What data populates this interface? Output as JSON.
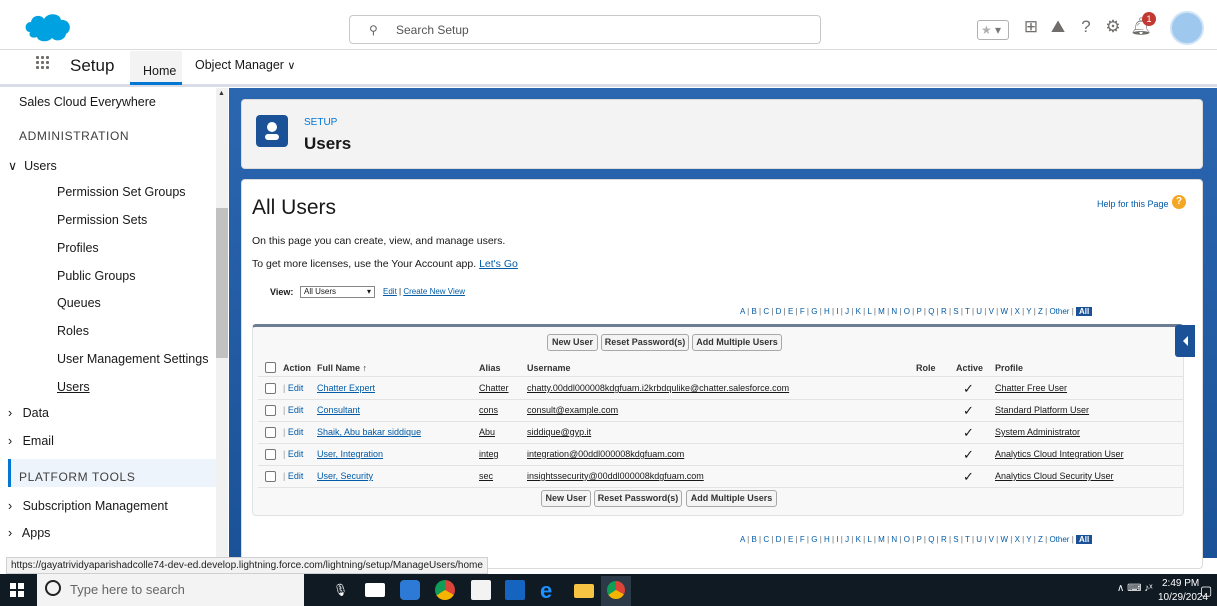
{
  "header": {
    "search_placeholder": "Search Setup",
    "notification_count": "1"
  },
  "nav": {
    "app_name": "Setup",
    "tabs": [
      "Home",
      "Object Manager"
    ]
  },
  "sidebar": {
    "top_item": "Sales Cloud Everywhere",
    "section_admin": "ADMINISTRATION",
    "users_group": "Users",
    "users_children": [
      "Permission Set Groups",
      "Permission Sets",
      "Profiles",
      "Public Groups",
      "Queues",
      "Roles",
      "User Management Settings",
      "Users"
    ],
    "data": "Data",
    "email": "Email",
    "section_platform": "PLATFORM TOOLS",
    "subscription": "Subscription Management",
    "apps": "Apps"
  },
  "page_header": {
    "eyebrow": "SETUP",
    "title": "Users"
  },
  "main": {
    "title": "All Users",
    "help": "Help for this Page",
    "desc1": "On this page you can create, view, and manage users.",
    "desc2": "To get more licenses, use the Your Account app.",
    "lets_go": "Let's Go",
    "view_label": "View:",
    "view_value": "All Users",
    "edit_link": "Edit",
    "create_view": "Create New View",
    "alpha": [
      "A",
      "B",
      "C",
      "D",
      "E",
      "F",
      "G",
      "H",
      "I",
      "J",
      "K",
      "L",
      "M",
      "N",
      "O",
      "P",
      "Q",
      "R",
      "S",
      "T",
      "U",
      "V",
      "W",
      "X",
      "Y",
      "Z",
      "Other",
      "All"
    ],
    "buttons": [
      "New User",
      "Reset Password(s)",
      "Add Multiple Users"
    ],
    "columns": [
      "Action",
      "Full Name ↑",
      "Alias",
      "Username",
      "Role",
      "Active",
      "Profile"
    ],
    "rows": [
      {
        "action": "Edit",
        "name": "Chatter Expert",
        "alias": "Chatter",
        "username": "chatty.00ddl000008kdgfuam.i2krbdqulike@chatter.salesforce.com",
        "active": "✓",
        "profile": "Chatter Free User"
      },
      {
        "action": "Edit",
        "name": "Consultant",
        "alias": "cons",
        "username": "consult@example.com",
        "active": "✓",
        "profile": "Standard Platform User"
      },
      {
        "action": "Edit",
        "name": "Shaik, Abu bakar siddique",
        "alias": "Abu",
        "username": "siddique@gyp.it",
        "active": "✓",
        "profile": "System Administrator"
      },
      {
        "action": "Edit",
        "name": "User, Integration",
        "alias": "integ",
        "username": "integration@00ddl000008kdgfuam.com",
        "active": "✓",
        "profile": "Analytics Cloud Integration User"
      },
      {
        "action": "Edit",
        "name": "User, Security",
        "alias": "sec",
        "username": "insightssecurity@00ddl000008kdgfuam.com",
        "active": "✓",
        "profile": "Analytics Cloud Security User"
      }
    ]
  },
  "statusbar": "https://gayatrividyaparishadcolle74-dev-ed.develop.lightning.force.com/lightning/setup/ManageUsers/home",
  "taskbar": {
    "search_placeholder": "Type here to search",
    "time": "2:49 PM",
    "date": "10/29/2024"
  },
  "colors": {
    "brand": "#0176d3",
    "banner": "#1b5297",
    "link": "#015ba7"
  }
}
